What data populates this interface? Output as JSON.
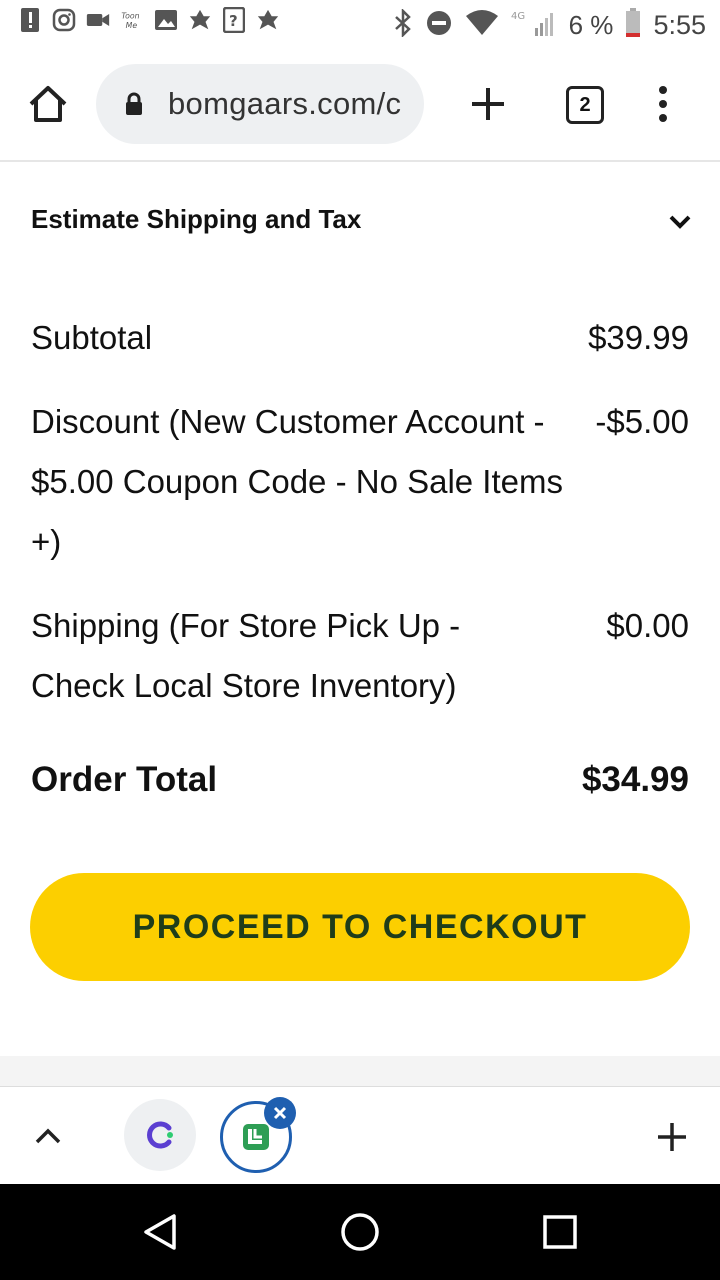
{
  "status_bar": {
    "time": "5:55",
    "battery": "6 %",
    "network": "4G"
  },
  "browser": {
    "url": "bomgaars.com/c",
    "tab_count": "2"
  },
  "cart": {
    "estimate_label": "Estimate Shipping and Tax",
    "subtotal_label": "Subtotal",
    "subtotal_value": "$39.99",
    "discount_label": "Discount (New Customer Account - $5.00 Coupon Code - No Sale Items +)",
    "discount_value": "-$5.00",
    "shipping_label": "Shipping (For Store Pick Up - Check Local Store Inventory)",
    "shipping_value": "$0.00",
    "total_label": "Order Total",
    "total_value": "$34.99",
    "checkout_label": "PROCEED TO CHECKOUT"
  },
  "colors": {
    "checkout_button": "#fccf00",
    "checkout_text": "#1f3d1a",
    "accent_blue": "#1f5fb0"
  }
}
